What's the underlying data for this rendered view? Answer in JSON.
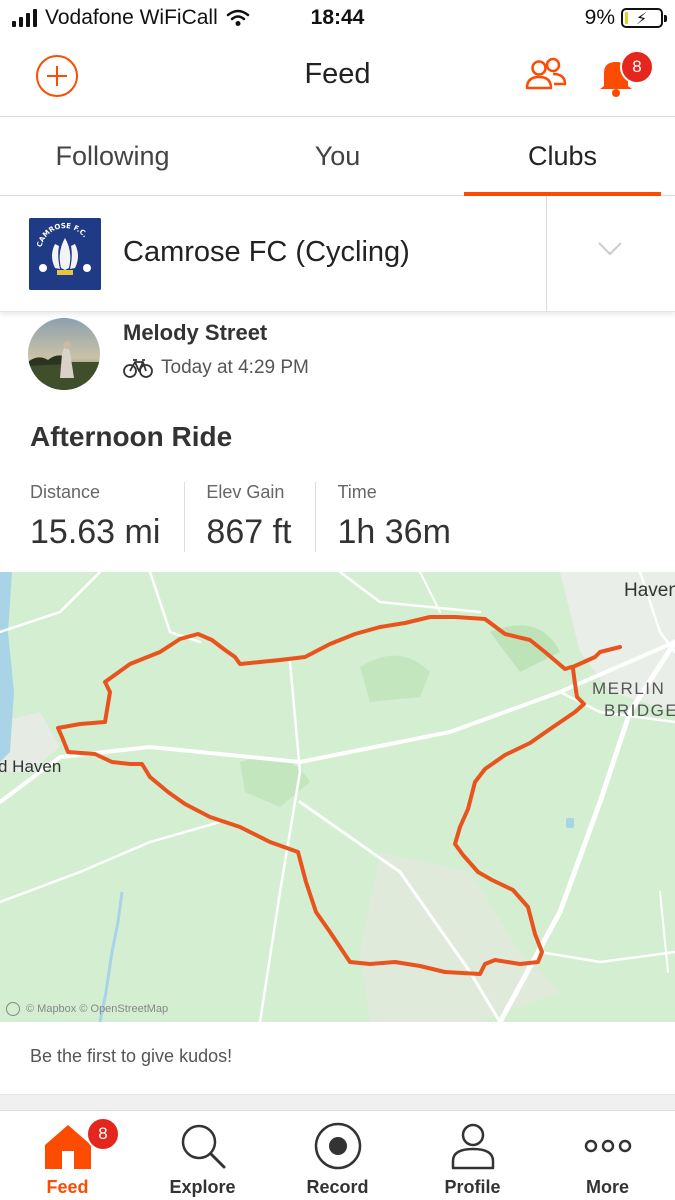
{
  "status_bar": {
    "carrier": "Vodafone WiFiCall",
    "time": "18:44",
    "battery": "9%",
    "battery_level": 0.09
  },
  "header": {
    "title": "Feed",
    "notification_count": "8",
    "accent_color": "#fc4c02",
    "badge_color": "#e4261c"
  },
  "tabs": [
    {
      "label": "Following",
      "active": false
    },
    {
      "label": "You",
      "active": false
    },
    {
      "label": "Clubs",
      "active": true
    }
  ],
  "club": {
    "name": "Camrose FC (Cycling)",
    "logo_text": "CAMROSE F.C.",
    "logo_color": "#1f3b86"
  },
  "activity": {
    "athlete": "Melody Street",
    "type_icon": "bike-icon",
    "timestamp": "Today at 4:29 PM",
    "title": "Afternoon Ride",
    "stats": [
      {
        "label": "Distance",
        "value": "15.63 mi"
      },
      {
        "label": "Elev Gain",
        "value": "867 ft"
      },
      {
        "label": "Time",
        "value": "1h 36m"
      }
    ],
    "kudos_prompt": "Be the first to give kudos!"
  },
  "map": {
    "labels": {
      "haven": "Haven",
      "merlin": "MERLIN",
      "bridge": "BRIDGE",
      "d_haven": "d Haven"
    },
    "attribution": "© Mapbox © OpenStreetMap",
    "route_color": "#e9541e",
    "land_color": "#d3eed0"
  },
  "bottom_nav": [
    {
      "label": "Feed",
      "icon": "home-icon",
      "active": true,
      "badge": "8"
    },
    {
      "label": "Explore",
      "icon": "search-icon",
      "active": false
    },
    {
      "label": "Record",
      "icon": "record-icon",
      "active": false
    },
    {
      "label": "Profile",
      "icon": "person-icon",
      "active": false
    },
    {
      "label": "More",
      "icon": "more-icon",
      "active": false
    }
  ]
}
